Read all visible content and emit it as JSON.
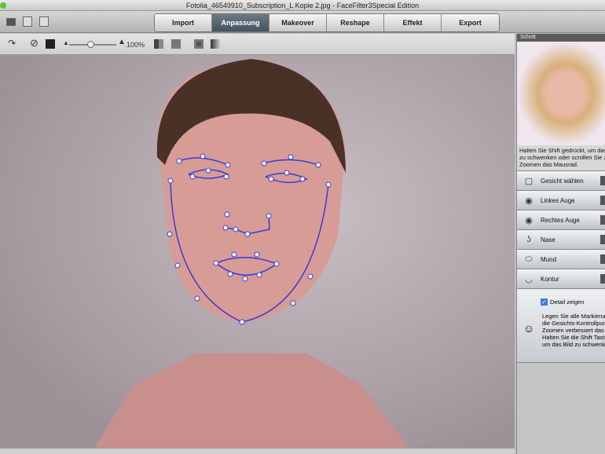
{
  "window": {
    "title": "Fotolia_46549910_Subscription_L Kopie 2.jpg - FaceFilter3Special Edition"
  },
  "tabs": [
    {
      "label": "Import"
    },
    {
      "label": "Anpassung",
      "active": true
    },
    {
      "label": "Makeover"
    },
    {
      "label": "Reshape"
    },
    {
      "label": "Effekt"
    },
    {
      "label": "Export"
    }
  ],
  "subtoolbar": {
    "zoom": "100%",
    "zoom_fraction": 0.45
  },
  "panel": {
    "title": "Schritt",
    "hint": [
      "Halten Sie Shift gedrückt, um das B",
      "zu schwenken oder scrollen Sie zu",
      "Zoomen das Mausrad."
    ],
    "steps": [
      {
        "label": "Gesicht wählen",
        "icon": "select-face-icon"
      },
      {
        "label": "Linkes Auge",
        "icon": "eye-icon"
      },
      {
        "label": "Rechtes Auge",
        "icon": "eye-icon"
      },
      {
        "label": "Nase",
        "icon": "nose-icon"
      },
      {
        "label": "Mund",
        "icon": "mouth-icon"
      },
      {
        "label": "Kontur",
        "icon": "contour-icon"
      }
    ],
    "detail_label": "Detail zeigen",
    "detail_checked": true,
    "detail_text": [
      "Legen Sie alle Markierunger",
      "die Gesichts-Kontrollpunkte",
      "Zoomen verbessert das Erg",
      "Halten Sie die Shift Taste ge",
      "um das Bild zu schwenken."
    ]
  },
  "colors": {
    "accent": "#3b3bd6",
    "tab_active": "#52606a"
  }
}
